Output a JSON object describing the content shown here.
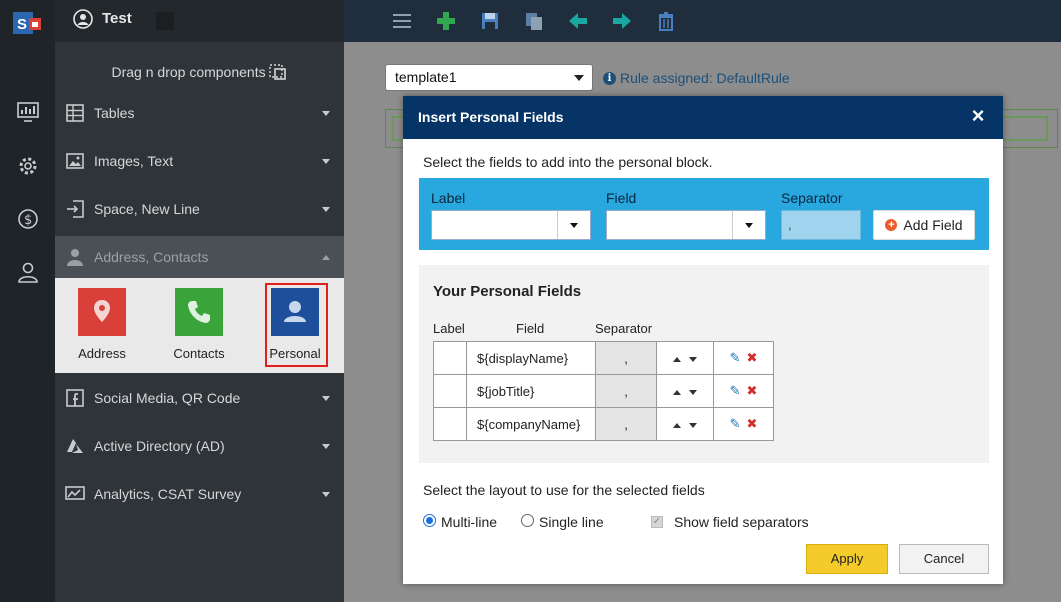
{
  "app": {
    "user_name": "Test"
  },
  "sidebar": {
    "drag_hint": "Drag n drop components",
    "sections": [
      {
        "label": "Tables",
        "icon": "table-icon"
      },
      {
        "label": "Images, Text",
        "icon": "image-icon"
      },
      {
        "label": "Space, New Line",
        "icon": "newline-icon"
      },
      {
        "label": "Address, Contacts",
        "icon": "person-icon"
      },
      {
        "label": "Social Media, QR Code",
        "icon": "facebook-icon"
      },
      {
        "label": "Active Directory (AD)",
        "icon": "azure-icon"
      },
      {
        "label": "Analytics, CSAT Survey",
        "icon": "analytics-icon"
      }
    ],
    "tiles": [
      {
        "label": "Address",
        "color": "#d9403a"
      },
      {
        "label": "Contacts",
        "color": "#3aa33a"
      },
      {
        "label": "Personal",
        "color": "#1d4f9a"
      }
    ]
  },
  "toolbar": {
    "icons": [
      "menu-icon",
      "add-icon",
      "save-icon",
      "copy-icon",
      "back-icon",
      "forward-icon",
      "delete-icon"
    ]
  },
  "main": {
    "template_value": "template1",
    "rule_text": "Rule assigned: DefaultRule"
  },
  "modal": {
    "title": "Insert Personal Fields",
    "instructions": "Select the fields to add into the personal block.",
    "label_header": "Label",
    "field_header": "Field",
    "separator_header": "Separator",
    "separator_value": ",",
    "add_field_label": "Add Field",
    "your_fields_title": "Your Personal Fields",
    "table_headers": [
      "Label",
      "Field",
      "Separator"
    ],
    "rows": [
      {
        "label": "",
        "field": "${displayName}",
        "separator": ","
      },
      {
        "label": "",
        "field": "${jobTitle}",
        "separator": ","
      },
      {
        "label": "",
        "field": "${companyName}",
        "separator": ","
      }
    ],
    "layout_prompt": "Select the layout to use for the selected fields",
    "multi_line_label": "Multi-line",
    "single_line_label": "Single line",
    "show_separators_label": "Show field separators",
    "apply_label": "Apply",
    "cancel_label": "Cancel"
  },
  "colors": {
    "accent": "#29a8e0",
    "header": "#063466",
    "apply": "#f5cb2b"
  }
}
